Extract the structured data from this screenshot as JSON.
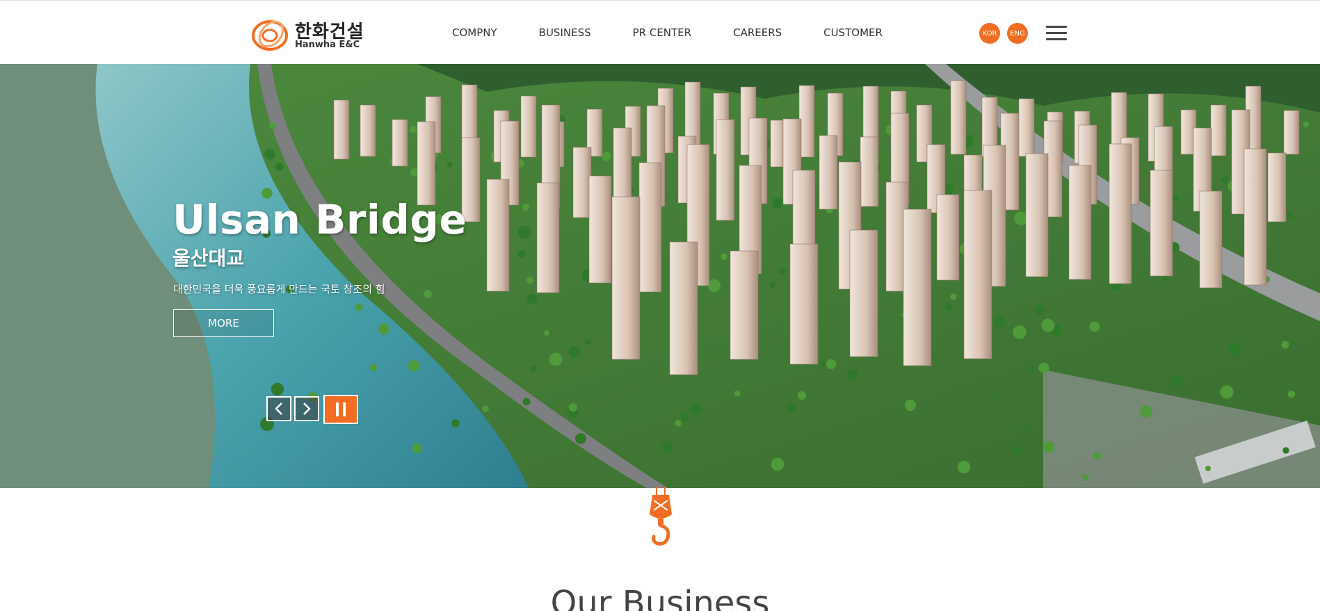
{
  "header": {
    "logo": {
      "korean": "한화건설",
      "english": "Hanwha E&C",
      "icon": "hanwha-logo-icon"
    },
    "nav": [
      {
        "label": "COMPNY"
      },
      {
        "label": "BUSINESS"
      },
      {
        "label": "PR CENTER"
      },
      {
        "label": "CAREERS"
      },
      {
        "label": "CUSTOMER"
      }
    ],
    "languages": {
      "kor": "KOR",
      "eng": "ENG"
    },
    "menu_icon": "hamburger-icon"
  },
  "hero": {
    "title": "Ulsan Bridge",
    "subtitle": "울산대교",
    "description": "대한민국을 더욱 풍요롭게 만드는 국토 창조의 힘",
    "more_label": "MORE",
    "controls": {
      "prev_icon": "chevron-left-icon",
      "next_icon": "chevron-right-icon",
      "pause_icon": "pause-icon"
    }
  },
  "section": {
    "title": "Our Business",
    "hook_icon": "crane-hook-icon"
  },
  "colors": {
    "accent": "#f26d21",
    "text": "#333333",
    "background": "#ffffff"
  }
}
